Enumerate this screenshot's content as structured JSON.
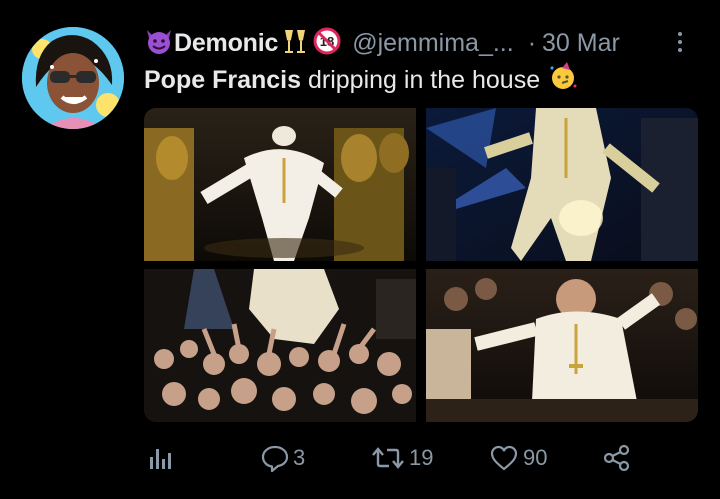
{
  "tweet": {
    "display_name": "Demonic",
    "handle": "@jemmima_...",
    "separator": "·",
    "date": "30 Mar",
    "text_mention": "Pope Francis",
    "text_rest": "dripping in the house",
    "name_emojis": [
      "smiling-devil-emoji",
      "champagne-glasses-emoji",
      "no-one-under-18-emoji"
    ],
    "text_emoji": "partying-face-emoji"
  },
  "media": [
    {
      "name": "media-image-1",
      "alt_icon": "photo"
    },
    {
      "name": "media-image-2",
      "alt_icon": "photo"
    },
    {
      "name": "media-image-3",
      "alt_icon": "photo"
    },
    {
      "name": "media-image-4",
      "alt_icon": "photo"
    }
  ],
  "actions": {
    "views_icon": "analytics-icon",
    "reply_count": "3",
    "retweet_count": "19",
    "like_count": "90",
    "share_icon": "share-icon"
  },
  "colors": {
    "background": "#000000",
    "primary_text": "#e7e9ea",
    "secondary_text": "#8b98a5"
  }
}
